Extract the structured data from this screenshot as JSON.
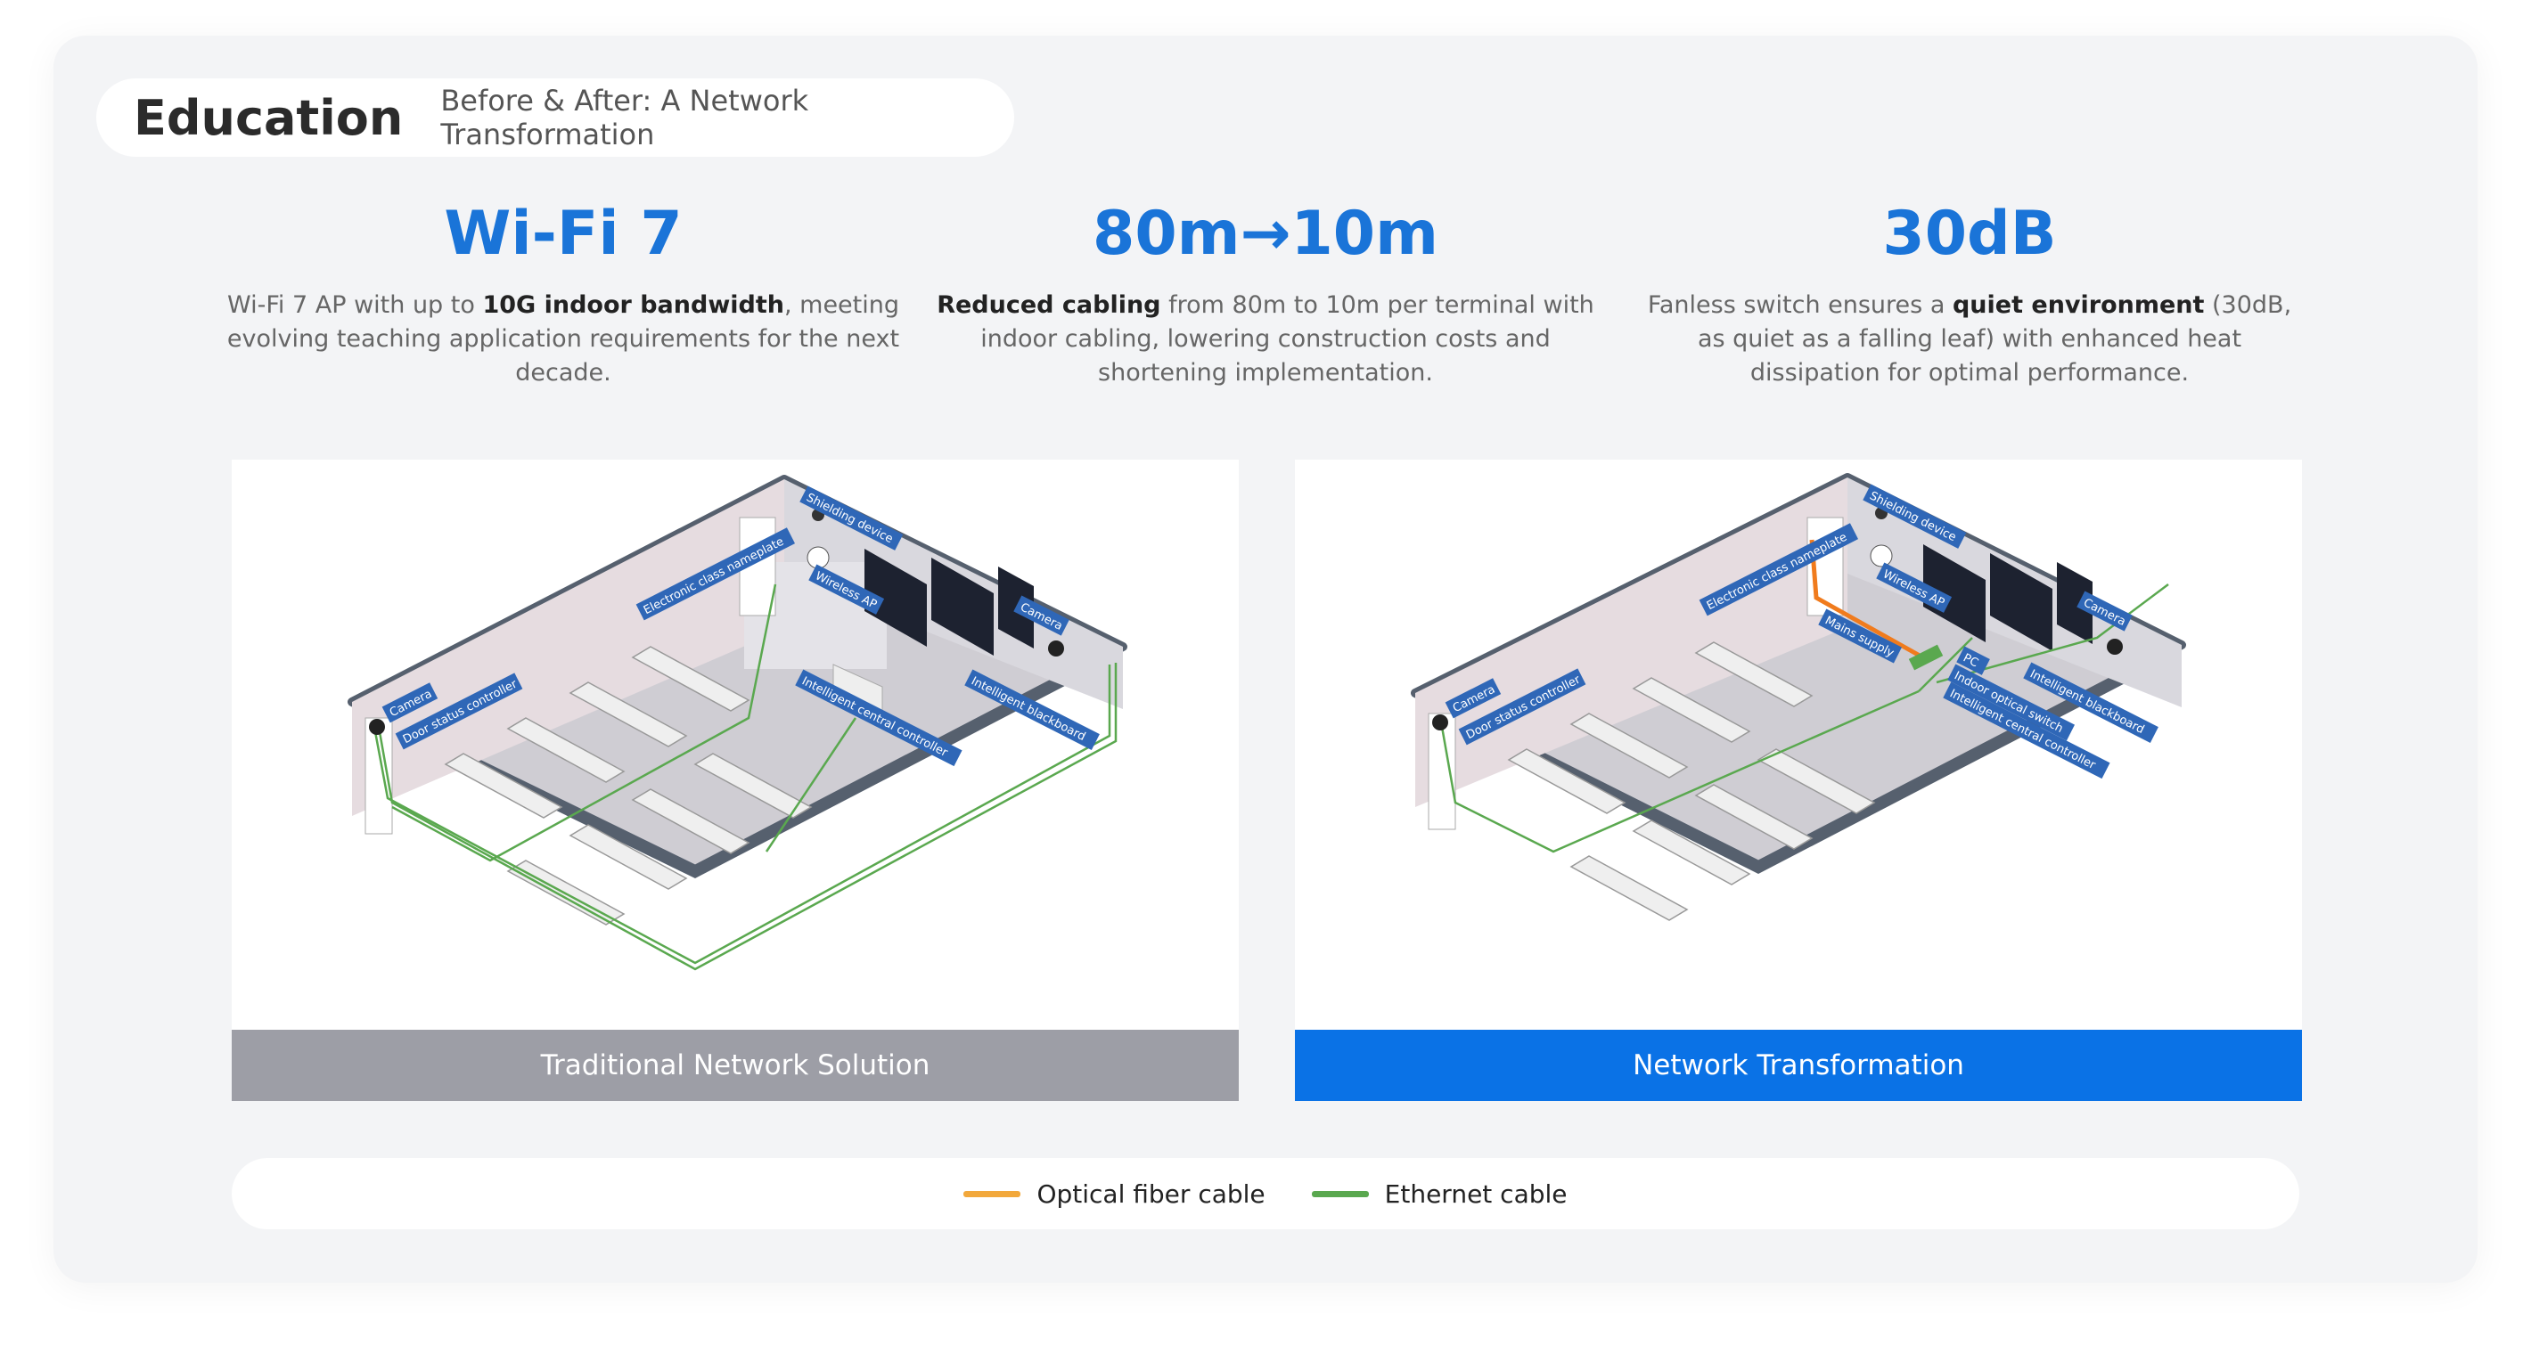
{
  "header": {
    "title": "Education",
    "subtitle": "Before & After: A Network Transformation"
  },
  "stats": [
    {
      "value": "Wi-Fi 7",
      "desc_pre": "Wi-Fi 7 AP with up to ",
      "desc_bold": "10G indoor bandwidth",
      "desc_post": ", meeting evolving teaching application requirements for the next decade."
    },
    {
      "value": "80m→10m",
      "desc_pre": "",
      "desc_bold": "Reduced cabling",
      "desc_post": " from 80m to 10m per terminal with indoor cabling, lowering construction costs and shortening implementation."
    },
    {
      "value": "30dB",
      "desc_pre": "Fanless switch ensures a ",
      "desc_bold": "quiet environment",
      "desc_post": " (30dB, as quiet as a falling leaf) with enhanced heat dissipation for optimal performance."
    }
  ],
  "panels": {
    "left": {
      "caption": "Traditional Network Solution",
      "caption_color": "#9d9ea6",
      "labels": {
        "shielding": "Shielding device",
        "nameplate": "Electronic class nameplate",
        "wireless_ap": "Wireless AP",
        "camera_right": "Camera",
        "camera_left": "Camera",
        "door": "Door status controller",
        "central": "Intelligent central controller",
        "blackboard": "Intelligent blackboard"
      }
    },
    "right": {
      "caption": "Network Transformation",
      "caption_color": "#0a72e6",
      "labels": {
        "shielding": "Shielding device",
        "nameplate": "Electronic class nameplate",
        "wireless_ap": "Wireless AP",
        "camera_right": "Camera",
        "camera_left": "Camera",
        "door": "Door status controller",
        "mains": "Mains supply",
        "pc": "PC",
        "switch": "Indoor optical switch",
        "central": "Intelligent central controller",
        "blackboard": "Intelligent blackboard"
      }
    }
  },
  "legend": [
    {
      "label": "Optical fiber cable",
      "color": "#f2a83b"
    },
    {
      "label": "Ethernet cable",
      "color": "#5aa84f"
    }
  ],
  "colors": {
    "accent": "#1a74d8",
    "label_bg": "#2f67b7",
    "ethernet": "#5aa84f",
    "fiber": "#f07b1d"
  }
}
